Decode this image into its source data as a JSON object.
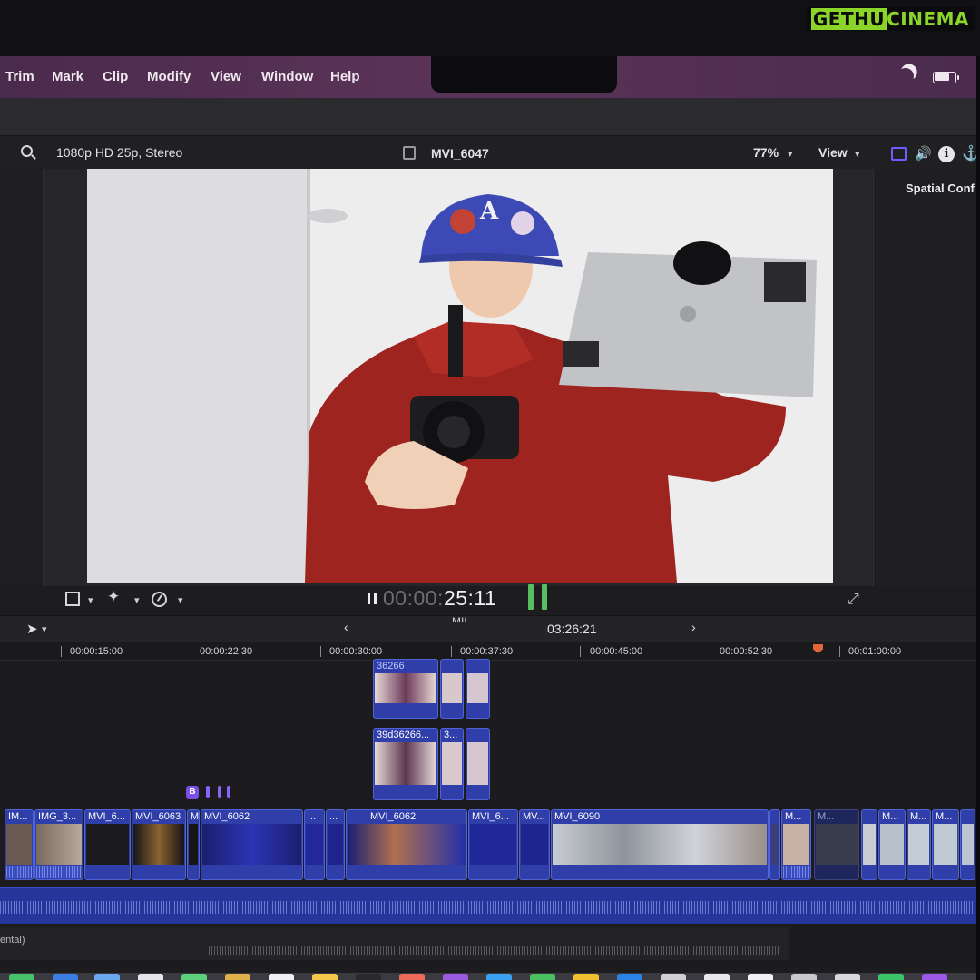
{
  "watermark": {
    "part1": "GETHU",
    "part2": "CINEMA"
  },
  "menubar": {
    "items": [
      "Trim",
      "Mark",
      "Clip",
      "Modify",
      "View",
      "Window",
      "Help"
    ]
  },
  "viewer": {
    "format": "1080p HD 25p, Stereo",
    "clip_name": "MVI_6047",
    "zoom": "77%",
    "view_label": "View",
    "timecode_dim": "00:00:",
    "timecode_lit": "25:11"
  },
  "inspector": {
    "title": "Spatial Conf"
  },
  "timeline": {
    "project_duration": "03:26:21",
    "partial_title": "MIL",
    "ruler": [
      "00:00:15:00",
      "00:00:22:30",
      "00:00:30:00",
      "00:00:37:30",
      "00:00:45:00",
      "00:00:52:30",
      "00:01:00:00"
    ],
    "connected_top_label": "36266",
    "connected_mid_labels": [
      "39d36266...",
      "3..."
    ],
    "marker_label": "B",
    "primary_clips": [
      "IM...",
      "IMG_3...",
      "MVI_6...",
      "MVI_6063",
      "M",
      "MVI_6062",
      "...",
      "...",
      "MVI_6062",
      "MVI_6...",
      "MV...",
      "MVI_6090",
      "M...",
      "M...",
      "M...",
      "M...",
      "M..."
    ],
    "audio_lane_label": "ental)"
  }
}
